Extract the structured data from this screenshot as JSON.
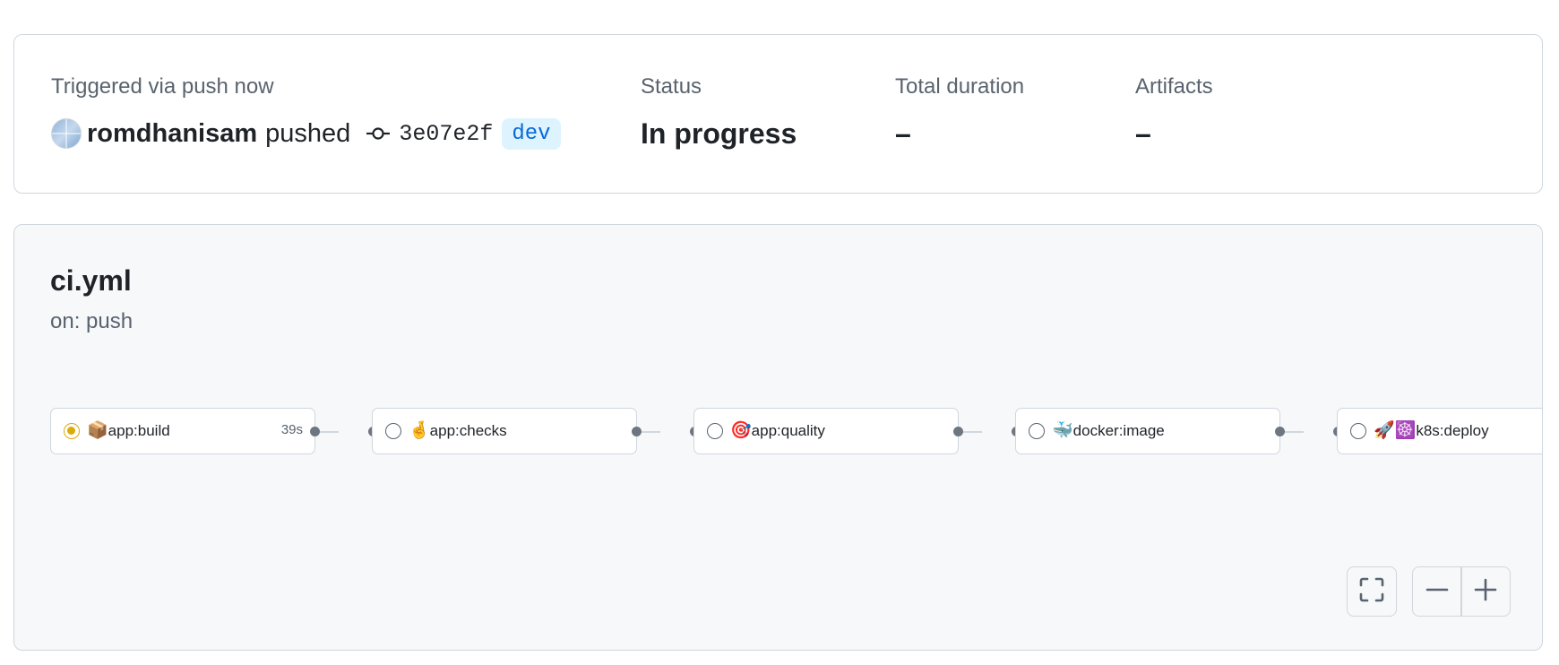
{
  "summary": {
    "trigger_label": "Triggered via push now",
    "actor": "romdhanisam",
    "action": "pushed",
    "commit_sha": "3e07e2f",
    "branch": "dev",
    "status_label": "Status",
    "status_value": "In progress",
    "duration_label": "Total duration",
    "duration_value": "–",
    "artifacts_label": "Artifacts",
    "artifacts_value": "–"
  },
  "workflow": {
    "name": "ci.yml",
    "trigger": "on: push",
    "jobs": [
      {
        "emoji": "📦",
        "name": "app:build",
        "status": "in_progress",
        "duration": "39s"
      },
      {
        "emoji": "🤞",
        "name": "app:checks",
        "status": "queued",
        "duration": ""
      },
      {
        "emoji": "🎯",
        "name": "app:quality",
        "status": "queued",
        "duration": ""
      },
      {
        "emoji": "🐳",
        "name": "docker:image",
        "status": "queued",
        "duration": ""
      },
      {
        "emoji": "🚀☸️",
        "name": "k8s:deploy",
        "status": "queued",
        "duration": ""
      }
    ]
  },
  "icons": {
    "commit": "git-commit-icon",
    "fullscreen": "fullscreen-icon",
    "zoom_out": "minus-icon",
    "zoom_in": "plus-icon"
  },
  "colors": {
    "running": "#dbab0a",
    "branch_text": "#0969da",
    "branch_bg": "#ddf4ff"
  }
}
